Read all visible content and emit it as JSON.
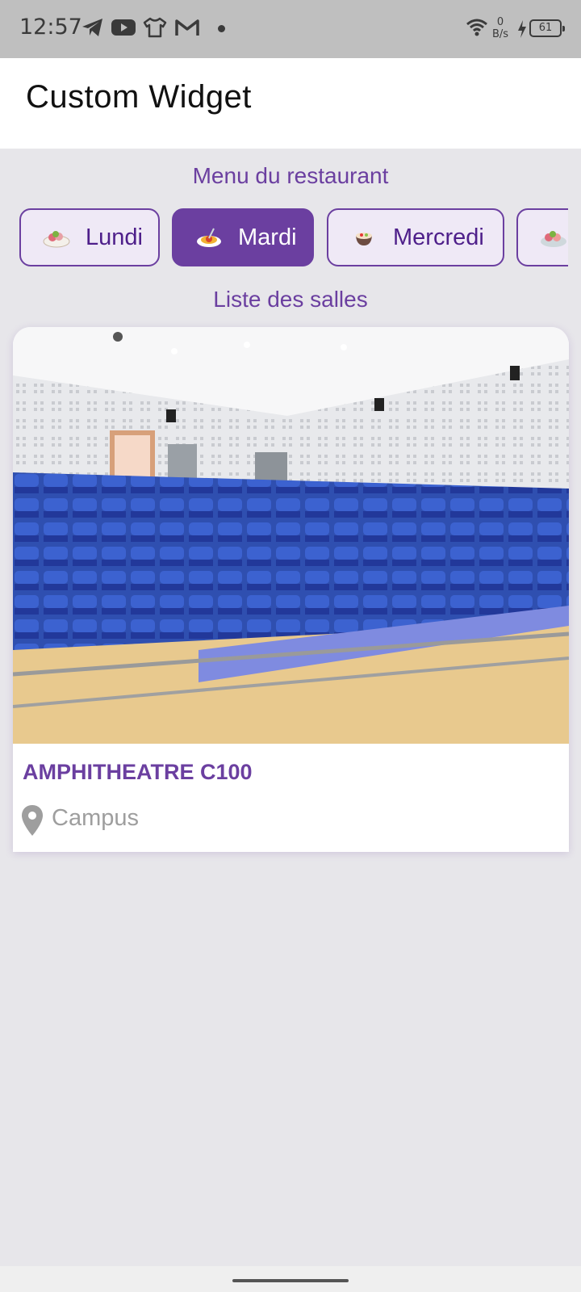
{
  "status_bar": {
    "time": "12:57",
    "net_speed_value": "0",
    "net_speed_unit": "B/s",
    "battery": "61",
    "icons": [
      "telegram-icon",
      "youtube-icon",
      "shirt-icon",
      "gmail-icon",
      "dot-icon",
      "wifi-icon",
      "charging-icon",
      "battery-icon"
    ]
  },
  "app_bar": {
    "title": "Custom Widget"
  },
  "menu": {
    "title": "Menu du restaurant",
    "days": [
      {
        "label": "Lundi",
        "selected": false,
        "icon": "salad-plate-icon"
      },
      {
        "label": "Mardi",
        "selected": true,
        "icon": "spaghetti-icon"
      },
      {
        "label": "Mercredi",
        "selected": false,
        "icon": "bowl-icon"
      },
      {
        "label": "",
        "selected": false,
        "icon": "food-plate-icon"
      }
    ]
  },
  "rooms": {
    "title": "Liste des salles",
    "items": [
      {
        "name": "AMPHITHEATRE C100",
        "location": "Campus",
        "image": "amphitheater-photo"
      }
    ]
  },
  "colors": {
    "accent": "#6b3fa0",
    "background": "#e7e6ea",
    "status_bar": "#bfbfbf"
  }
}
